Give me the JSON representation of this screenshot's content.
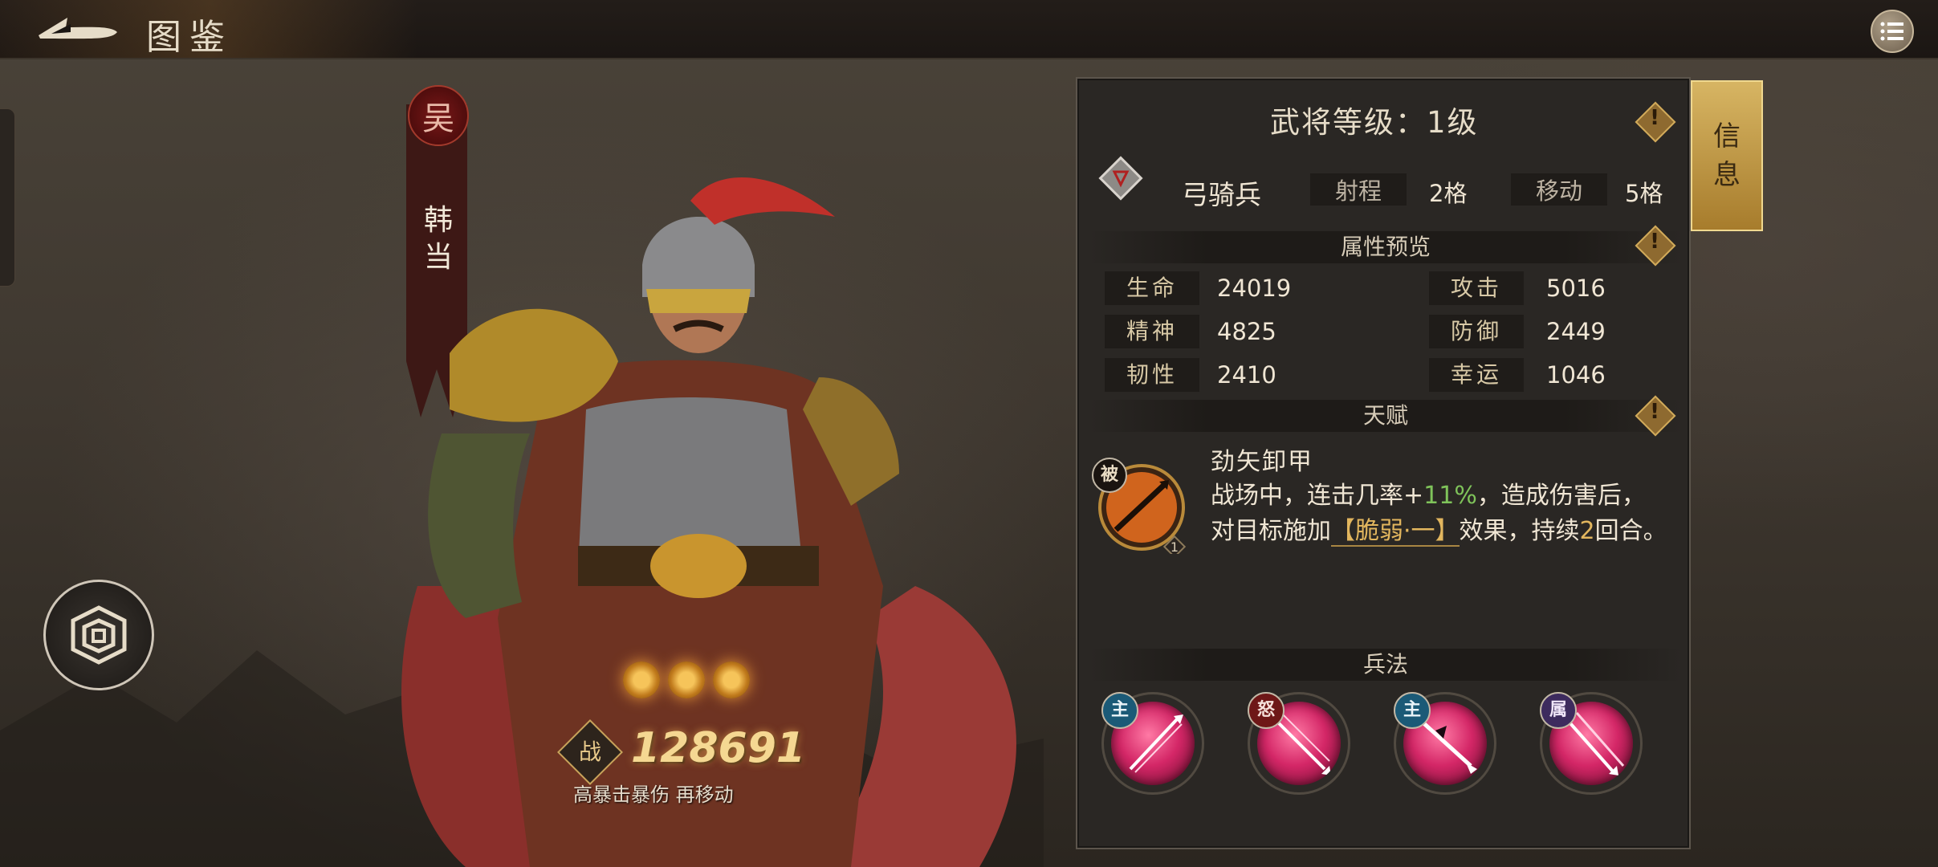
{
  "header": {
    "title": "图鉴"
  },
  "hero": {
    "faction": "吴",
    "name": "韩当",
    "power_label": "战",
    "power": "128691",
    "tags": "高暴击暴伤 再移动",
    "stars": 3
  },
  "panel": {
    "side_tab": [
      "信",
      "息"
    ],
    "level_label": "武将等级：",
    "level_value": "1级",
    "unit": {
      "type": "弓骑兵",
      "range_label": "射程",
      "range_value": "2格",
      "move_label": "移动",
      "move_value": "5格"
    },
    "attributes": {
      "header": "属性预览",
      "items": [
        {
          "label": "生命",
          "value": "24019"
        },
        {
          "label": "攻击",
          "value": "5016"
        },
        {
          "label": "精神",
          "value": "4825"
        },
        {
          "label": "防御",
          "value": "2449"
        },
        {
          "label": "韧性",
          "value": "2410"
        },
        {
          "label": "幸运",
          "value": "1046"
        }
      ]
    },
    "talent": {
      "header": "天赋",
      "badge": "被",
      "level": "1",
      "name": "劲矢卸甲",
      "desc_1": "战场中，连击几率+",
      "desc_pct": "11%",
      "desc_2": "，造成伤害后，对目标施加",
      "desc_link": "【脆弱·一】",
      "desc_3": "效果，持续",
      "desc_turns": "2",
      "desc_4": "回合。"
    },
    "tactics": {
      "header": "兵法",
      "items": [
        {
          "badge": "主"
        },
        {
          "badge": "怒"
        },
        {
          "badge": "主"
        },
        {
          "badge": "属"
        }
      ]
    }
  },
  "colors": {
    "accent_gold": "#e2b65e",
    "value_green": "#7fc35a",
    "panel_bg": "#2a2724"
  }
}
